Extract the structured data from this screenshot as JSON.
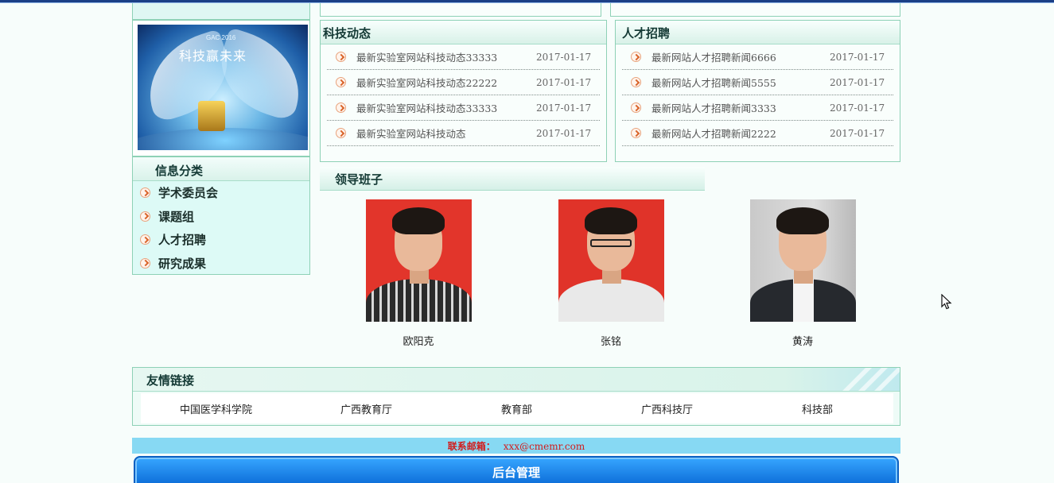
{
  "banner": {
    "small_text": "GAC 2016",
    "title_text": "科技赢未来"
  },
  "categories": {
    "title": "信息分类",
    "items": [
      "学术委员会",
      "课题组",
      "人才招聘",
      "研究成果"
    ]
  },
  "tech_news": {
    "title": "科技动态",
    "items": [
      {
        "title": "最新实验室网站科技动态33333",
        "date": "2017-01-17"
      },
      {
        "title": "最新实验室网站科技动态22222",
        "date": "2017-01-17"
      },
      {
        "title": "最新实验室网站科技动态33333",
        "date": "2017-01-17"
      },
      {
        "title": "最新实验室网站科技动态",
        "date": "2017-01-17"
      }
    ]
  },
  "talent_news": {
    "title": "人才招聘",
    "items": [
      {
        "title": "最新网站人才招聘新闻6666",
        "date": "2017-01-17"
      },
      {
        "title": "最新网站人才招聘新闻5555",
        "date": "2017-01-17"
      },
      {
        "title": "最新网站人才招聘新闻3333",
        "date": "2017-01-17"
      },
      {
        "title": "最新网站人才招聘新闻2222",
        "date": "2017-01-17"
      }
    ]
  },
  "leaders": {
    "title": "领导班子",
    "people": [
      "欧阳克",
      "张铭",
      "黄涛"
    ]
  },
  "links": {
    "title": "友情链接",
    "items": [
      "中国医学科学院",
      "广西教育厅",
      "教育部",
      "广西科技厅",
      "科技部"
    ]
  },
  "footer": {
    "contact_label": "联系邮箱：",
    "contact_email": "xxx@cmemr.com",
    "admin_label": "后台管理"
  }
}
